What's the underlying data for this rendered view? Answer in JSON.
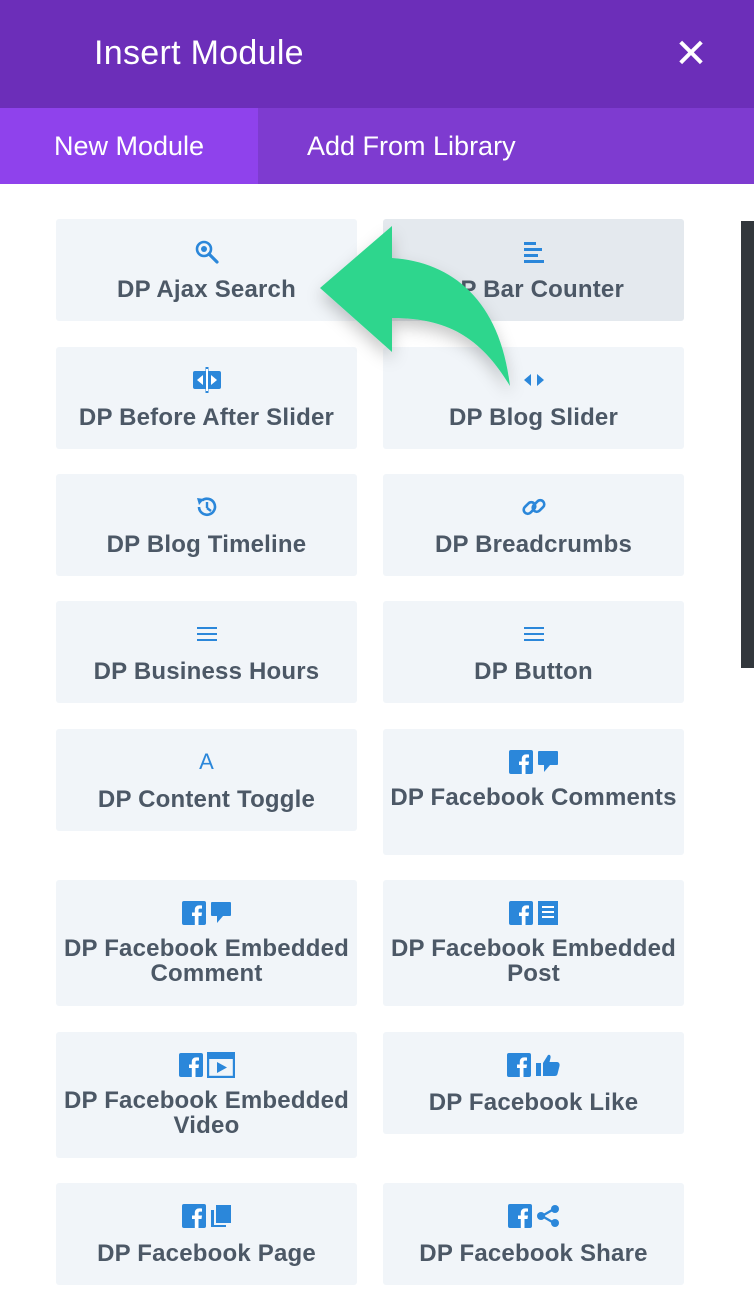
{
  "header": {
    "title": "Insert Module",
    "close_symbol": "✕"
  },
  "tabs": [
    {
      "label": "New Module"
    },
    {
      "label": "Add From Library"
    }
  ],
  "modules": [
    {
      "name": "DP Ajax Search",
      "icon": "search-icon"
    },
    {
      "name": "DP Bar Counter",
      "icon": "bar-lines-icon"
    },
    {
      "name": "DP Before After Slider",
      "icon": "before-after-icon"
    },
    {
      "name": "DP Blog Slider",
      "icon": "slider-arrows-icon"
    },
    {
      "name": "DP Blog Timeline",
      "icon": "history-clock-icon"
    },
    {
      "name": "DP Breadcrumbs",
      "icon": "link-icon"
    },
    {
      "name": "DP Business Hours",
      "icon": "menu-lines-icon"
    },
    {
      "name": "DP Button",
      "icon": "menu-lines-icon"
    },
    {
      "name": "DP Content Toggle",
      "icon": "letter-a-icon",
      "glyph": "A"
    },
    {
      "name": "DP Facebook Comments",
      "icon": "facebook-comment-icon"
    },
    {
      "name": "DP Facebook Embedded Comment",
      "icon": "facebook-comment-icon"
    },
    {
      "name": "DP Facebook Embedded Post",
      "icon": "facebook-post-icon"
    },
    {
      "name": "DP Facebook Embedded Video",
      "icon": "facebook-video-icon"
    },
    {
      "name": "DP Facebook Like",
      "icon": "facebook-like-icon"
    },
    {
      "name": "DP Facebook Page",
      "icon": "facebook-page-icon"
    },
    {
      "name": "DP Facebook Share",
      "icon": "facebook-share-icon"
    }
  ],
  "colors": {
    "header": "#6c2eb9",
    "tab_bar": "#7e3bd0",
    "active_tab": "#8f42ec",
    "icon": "#2b87da",
    "card": "#f1f5f9",
    "label": "#4c5866",
    "annotation_arrow": "#2ed68d"
  }
}
